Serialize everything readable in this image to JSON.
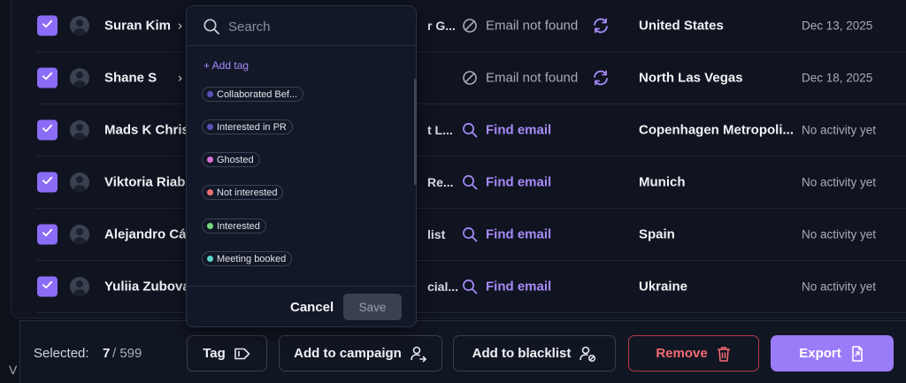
{
  "rows": [
    {
      "name": "Suran Kim",
      "chevron": "›",
      "title": "r G...",
      "email_status": "Email not found",
      "email_type": "nf",
      "location": "United States",
      "activity": "Dec 13, 2025"
    },
    {
      "name": "Shane S",
      "chevron": "›",
      "title": "",
      "email_status": "Email not found",
      "email_type": "nf",
      "location": "North Las Vegas",
      "activity": "Dec 18, 2025"
    },
    {
      "name": "Mads K Christ",
      "chevron": "",
      "title": "t L...",
      "email_status": "Find email",
      "email_type": "find",
      "location": "Copenhagen Metropoli...",
      "activity": "No activity yet"
    },
    {
      "name": "Viktoria Riabe",
      "chevron": "",
      "title": "Re...",
      "email_status": "Find email",
      "email_type": "find",
      "location": "Munich",
      "activity": "No activity yet"
    },
    {
      "name": "Alejandro Cár",
      "chevron": "",
      "title": "list",
      "email_status": "Find email",
      "email_type": "find",
      "location": "Spain",
      "activity": "No activity yet"
    },
    {
      "name": "Yuliia Zubova",
      "chevron": "",
      "title": "cial...",
      "email_status": "Find email",
      "email_type": "find",
      "location": "Ukraine",
      "activity": "No activity yet"
    }
  ],
  "dropdown": {
    "search_placeholder": "Search",
    "add_tag_label": "+ Add tag",
    "tags": [
      {
        "label": "Collaborated Bef...",
        "color": "#5b52b8"
      },
      {
        "label": "Interested in PR",
        "color": "#5b52b8"
      },
      {
        "label": "Ghosted",
        "color": "#d86fd6"
      },
      {
        "label": "Not interested",
        "color": "#f07171"
      },
      {
        "label": "Interested",
        "color": "#79d67e"
      },
      {
        "label": "Meeting booked",
        "color": "#5fd4cc"
      }
    ],
    "cancel_label": "Cancel",
    "save_label": "Save"
  },
  "bottombar": {
    "selected_label": "Selected:",
    "selected_count": "7",
    "selected_total": "/ 599",
    "tag_label": "Tag",
    "add_campaign_label": "Add to campaign",
    "add_blacklist_label": "Add to blacklist",
    "remove_label": "Remove",
    "export_label": "Export"
  },
  "left_edge_text": "V",
  "colors": {
    "accent": "#9b7cf8",
    "link": "#a78bfa",
    "danger": "#f26b72",
    "background": "#0d111a"
  }
}
